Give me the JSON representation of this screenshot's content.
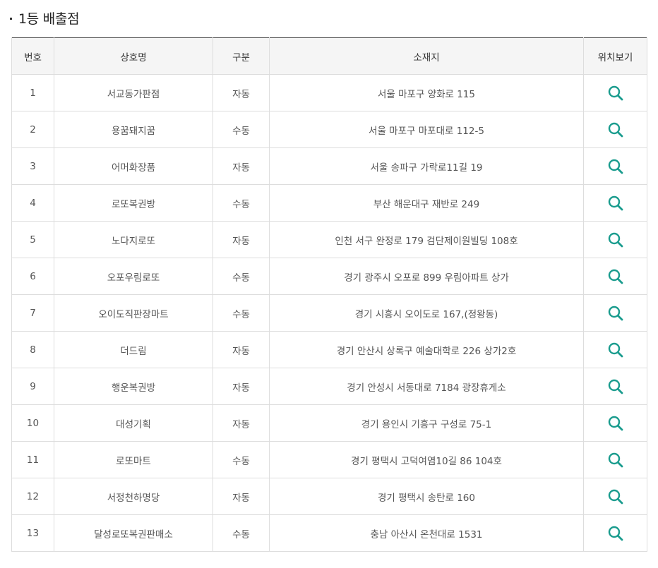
{
  "section": {
    "title": "1등 배출점"
  },
  "table": {
    "headers": {
      "no": "번호",
      "store": "상호명",
      "type": "구분",
      "address": "소재지",
      "location": "위치보기"
    },
    "rows": [
      {
        "no": "1",
        "store": "서교동가판점",
        "type": "자동",
        "address": "서울 마포구 양화로 115"
      },
      {
        "no": "2",
        "store": "용꿈돼지꿈",
        "type": "수동",
        "address": "서울 마포구 마포대로 112-5"
      },
      {
        "no": "3",
        "store": "어머화장품",
        "type": "자동",
        "address": "서울 송파구 가락로11길 19"
      },
      {
        "no": "4",
        "store": "로또복권방",
        "type": "수동",
        "address": "부산 해운대구 재반로 249"
      },
      {
        "no": "5",
        "store": "노다지로또",
        "type": "자동",
        "address": "인천 서구 완정로 179 검단제이원빌딩 108호"
      },
      {
        "no": "6",
        "store": "오포우림로또",
        "type": "수동",
        "address": "경기 광주시 오포로 899 우림아파트 상가"
      },
      {
        "no": "7",
        "store": "오이도직판장마트",
        "type": "수동",
        "address": "경기 시흥시 오이도로 167,(정왕동)"
      },
      {
        "no": "8",
        "store": "더드림",
        "type": "자동",
        "address": "경기 안산시 상록구 예술대학로 226 상가2호"
      },
      {
        "no": "9",
        "store": "행운복권방",
        "type": "자동",
        "address": "경기 안성시 서동대로 7184 광장휴게소"
      },
      {
        "no": "10",
        "store": "대성기획",
        "type": "자동",
        "address": "경기 용인시 기흥구 구성로 75-1"
      },
      {
        "no": "11",
        "store": "로또마트",
        "type": "수동",
        "address": "경기 평택시 고덕여염10길 86 104호"
      },
      {
        "no": "12",
        "store": "서정천하명당",
        "type": "자동",
        "address": "경기 평택시 송탄로 160"
      },
      {
        "no": "13",
        "store": "달성로또복권판매소",
        "type": "수동",
        "address": "충남 아산시 온천대로 1531"
      }
    ],
    "location_icon": "search-icon"
  },
  "colors": {
    "accent_icon": "#1a9c8e",
    "header_bg": "#f5f5f5",
    "top_border": "#444444",
    "cell_border": "#dddddd"
  }
}
